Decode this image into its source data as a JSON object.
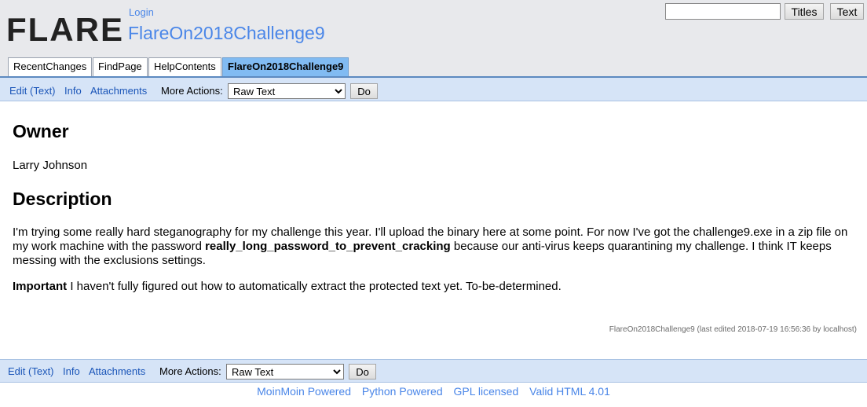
{
  "header": {
    "logo_text": "FLARE",
    "login": "Login",
    "page_title": "FlareOn2018Challenge9",
    "search": {
      "value": "",
      "titles_button": "Titles",
      "text_button": "Text"
    }
  },
  "tabs": [
    {
      "label": "RecentChanges"
    },
    {
      "label": "FindPage"
    },
    {
      "label": "HelpContents"
    },
    {
      "label": "FlareOn2018Challenge9",
      "active": true
    }
  ],
  "actions": {
    "edit": "Edit (Text)",
    "info": "Info",
    "attachments": "Attachments",
    "more_actions_label": "More Actions:",
    "selected_action": "Raw Text",
    "do_button": "Do"
  },
  "content": {
    "owner_heading": "Owner",
    "owner_name": "Larry Johnson",
    "description_heading": "Description",
    "description_part1": "I'm trying some really hard steganography for my challenge this year. I'll upload the binary here at some point. For now I've got the challenge9.exe in a zip file on my work machine with the password ",
    "password": "really_long_password_to_prevent_cracking",
    "description_part2": " because our anti-virus keeps quarantining my challenge. I think IT keeps messing with the exclusions settings.",
    "important_label": "Important",
    "important_text": " I haven't fully figured out how to automatically extract the protected text yet. To-be-determined."
  },
  "page_info": "FlareOn2018Challenge9 (last edited 2018-07-19 16:56:36 by localhost)",
  "footer": {
    "links": [
      "MoinMoin Powered",
      "Python Powered",
      "GPL licensed",
      "Valid HTML 4.01"
    ]
  },
  "colors": {
    "link": "#1a55b8",
    "title": "#4a86e8",
    "action_bar": "#d6e4f7",
    "active_tab": "#81bbf2"
  }
}
